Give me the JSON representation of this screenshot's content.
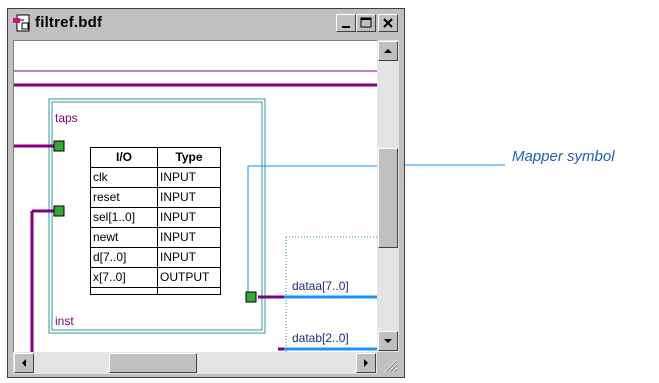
{
  "window": {
    "title": "filtref.bdf"
  },
  "symbol": {
    "name": "taps",
    "instance": "inst",
    "table": {
      "headers": [
        "I/O",
        "Type"
      ],
      "rows": [
        [
          "clk",
          "INPUT"
        ],
        [
          "reset",
          "INPUT"
        ],
        [
          "sel[1..0]",
          "INPUT"
        ],
        [
          "newt",
          "INPUT"
        ],
        [
          "d[7..0]",
          "INPUT"
        ],
        [
          "x[7..0]",
          "OUTPUT"
        ],
        [
          "",
          ""
        ]
      ]
    }
  },
  "wires": {
    "dataa": "dataa[7..0]",
    "datab": "datab[2..0]"
  },
  "callout": {
    "label": "Mapper symbol"
  },
  "colors": {
    "purple": "#800080",
    "teal": "#339999",
    "blue": "#1e90ff",
    "callout": "#1f5fb5"
  }
}
